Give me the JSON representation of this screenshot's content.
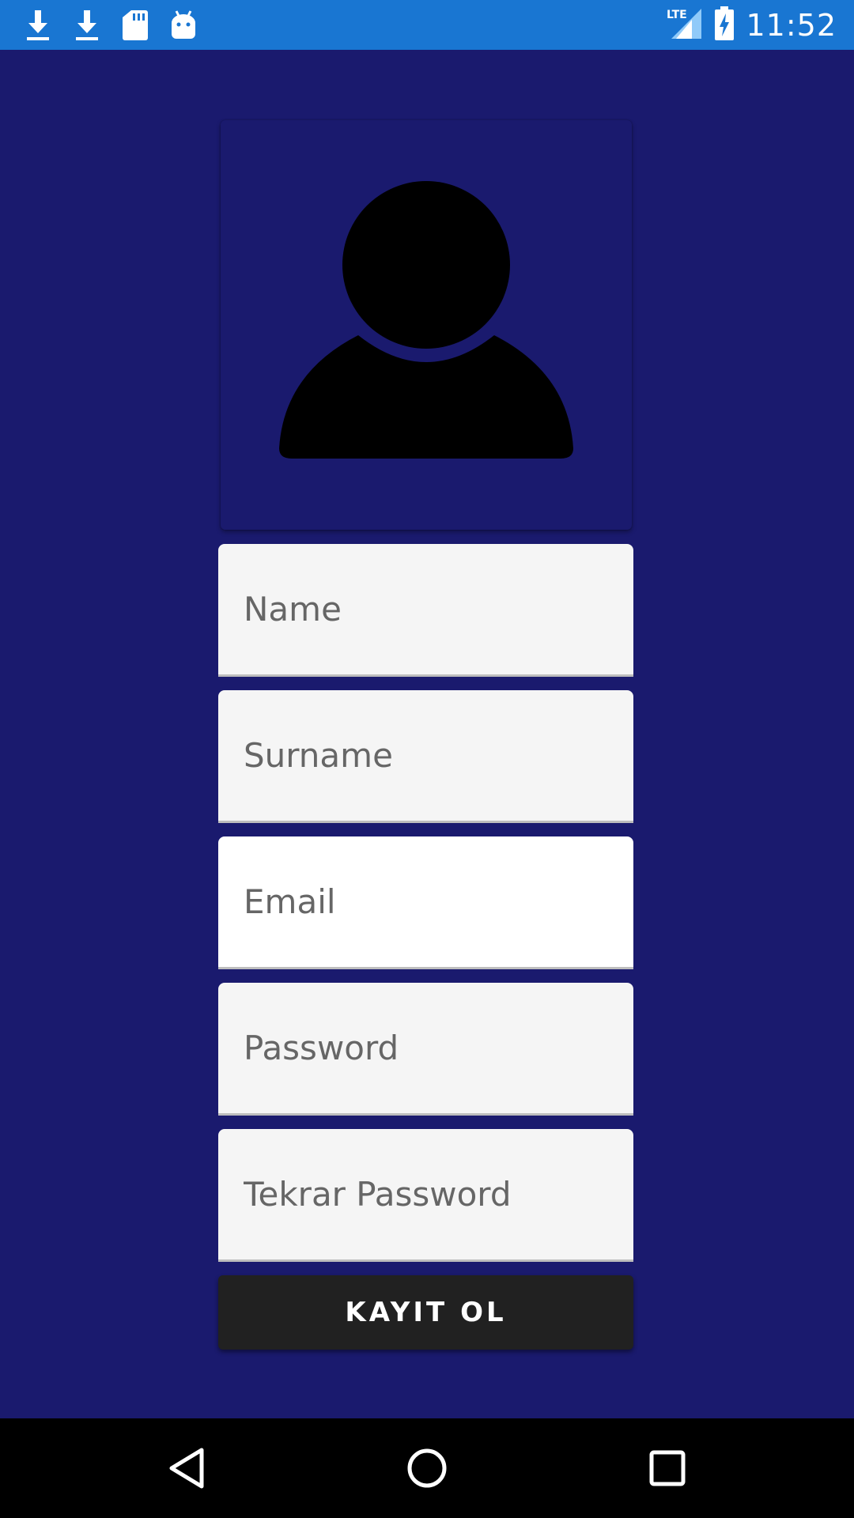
{
  "status_bar": {
    "time": "11:52",
    "network_label": "LTE",
    "icons": [
      "download-icon",
      "download-icon",
      "sd-card-icon",
      "android-icon",
      "signal-icon",
      "battery-charging-icon"
    ],
    "background_color": "#1976d2"
  },
  "avatar": {
    "icon": "person-icon"
  },
  "form": {
    "fields": [
      {
        "placeholder": "Name",
        "value": ""
      },
      {
        "placeholder": "Surname",
        "value": ""
      },
      {
        "placeholder": "Email",
        "value": ""
      },
      {
        "placeholder": "Password",
        "value": ""
      },
      {
        "placeholder": "Tekrar Password",
        "value": ""
      }
    ],
    "submit_label": "KAYIT OL"
  },
  "nav_bar": {
    "icons": [
      "back-icon",
      "home-icon",
      "recent-apps-icon"
    ]
  },
  "colors": {
    "background": "#1a1a6e",
    "field_background": "#f5f5f5",
    "button_background": "#212121"
  }
}
